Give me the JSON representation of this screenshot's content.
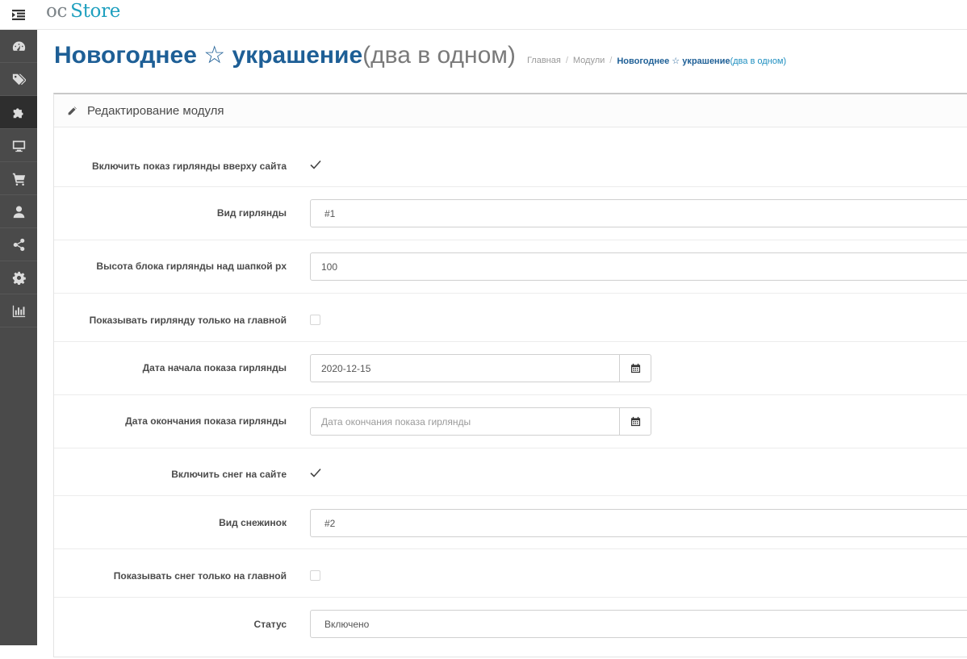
{
  "logo": {
    "oc": "oc",
    "store": "Store"
  },
  "sidebar": {
    "items": [
      {
        "icon": "dashboard-icon"
      },
      {
        "icon": "tags-icon"
      },
      {
        "icon": "puzzle-icon",
        "active": true
      },
      {
        "icon": "desktop-icon"
      },
      {
        "icon": "cart-icon"
      },
      {
        "icon": "user-icon"
      },
      {
        "icon": "share-icon"
      },
      {
        "icon": "cog-icon"
      },
      {
        "icon": "bar-chart-icon"
      }
    ]
  },
  "header": {
    "title_main": "Новогоднее ☆ украшение",
    "title_sub": "(два в одном)",
    "breadcrumb": [
      "Главная",
      "Модули"
    ],
    "breadcrumb_current_main": "Новогоднее ☆ украшение",
    "breadcrumb_current_sub": "(два в одном)"
  },
  "panel": {
    "title": "Редактирование модуля"
  },
  "form": {
    "garland_enable": {
      "label": "Включить показ гирлянды вверху сайта",
      "checked": true
    },
    "garland_type": {
      "label": "Вид гирлянды",
      "value": "#1"
    },
    "garland_height": {
      "label": "Высота блока гирлянды над шапкой px",
      "value": "100"
    },
    "garland_home_only": {
      "label": "Показывать гирлянду только на главной",
      "checked": false
    },
    "garland_start": {
      "label": "Дата начала показа гирлянды",
      "value": "2020-12-15"
    },
    "garland_end": {
      "label": "Дата окончания показа гирлянды",
      "placeholder": "Дата окончания показа гирлянды"
    },
    "snow_enable": {
      "label": "Включить снег на сайте",
      "checked": true
    },
    "snow_type": {
      "label": "Вид снежинок",
      "value": "#2"
    },
    "snow_home_only": {
      "label": "Показывать снег только на главной",
      "checked": false
    },
    "status": {
      "label": "Статус",
      "value": "Включено"
    }
  },
  "colors": {
    "accent": "#1e5f96",
    "sidebar_bg": "#4a4a4a",
    "logo_store": "#1fa0bf"
  }
}
